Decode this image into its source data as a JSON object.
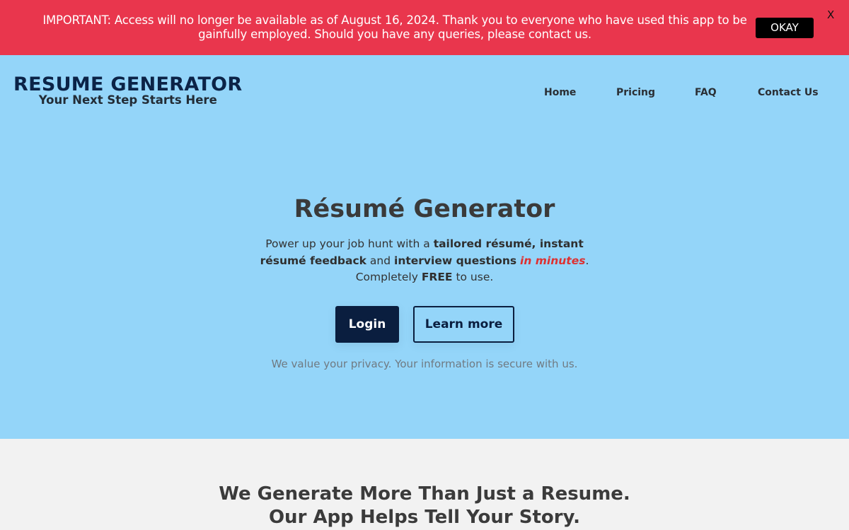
{
  "banner": {
    "message": "IMPORTANT: Access will no longer be available as of August 16, 2024. Thank you to everyone who have used this app to be gainfully employed. Should you have any queries, please contact us.",
    "okay_label": "OKAY",
    "close_label": "X",
    "background_color": "#e9364d"
  },
  "header": {
    "logo_title": "RESUME GENERATOR",
    "logo_tagline": "Your Next Step Starts Here",
    "nav": [
      {
        "label": "Home"
      },
      {
        "label": "Pricing"
      },
      {
        "label": "FAQ"
      },
      {
        "label": "Contact Us"
      }
    ]
  },
  "hero": {
    "title": "Résumé Generator",
    "desc": {
      "part1": "Power up your job hunt with a ",
      "bold1": "tailored résumé, instant résumé feedback",
      "part2": " and ",
      "bold2": "interview questions",
      "part3": " ",
      "highlight": "in minutes",
      "part4": ".",
      "part5": "Completely ",
      "bold3": "FREE",
      "part6": " to use."
    },
    "login_label": "Login",
    "learn_more_label": "Learn more",
    "privacy_note": "We value your privacy. Your information is secure with us.",
    "background_color": "#94d5f9",
    "accent_color": "#0a1e3f",
    "highlight_color": "#dd3131"
  },
  "section2": {
    "title_line1": "We Generate More Than Just a Resume.",
    "title_line2": "Our App Helps Tell Your Story."
  }
}
